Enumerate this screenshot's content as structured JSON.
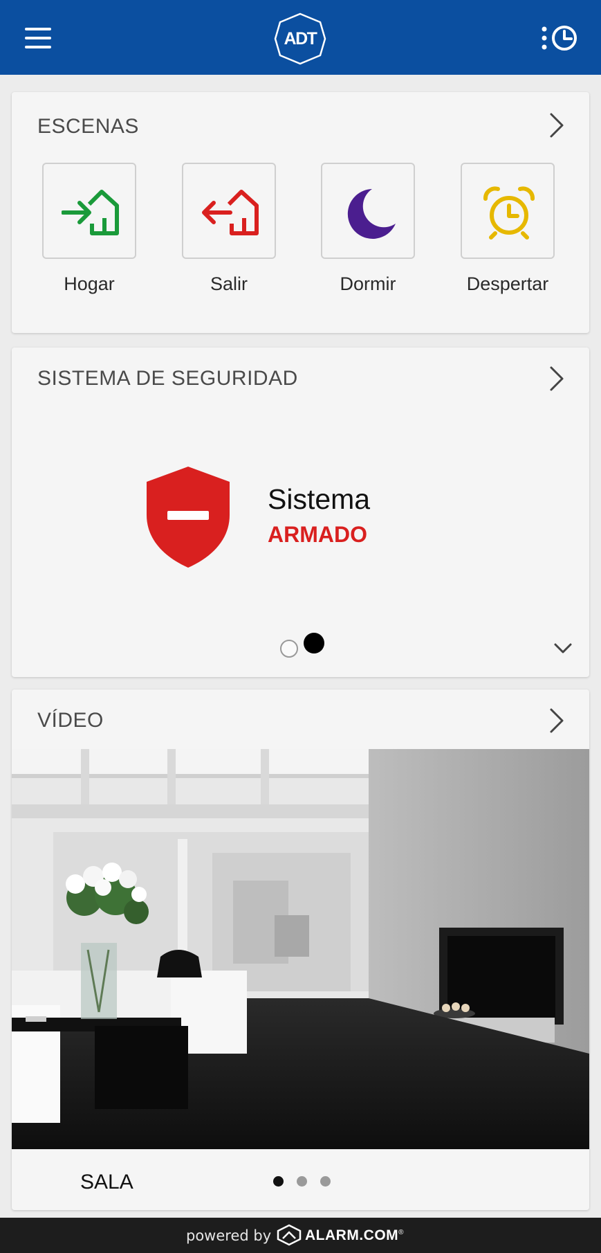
{
  "header": {
    "logo_text": "ADT",
    "menu_icon": "hamburger-menu-icon",
    "history_icon": "activity-history-icon",
    "bar_color": "#0b4fa0"
  },
  "scenes": {
    "title": "ESCENAS",
    "items": [
      {
        "label": "Hogar",
        "icon": "arrive-home-icon",
        "color": "#1a9a3a"
      },
      {
        "label": "Salir",
        "icon": "leave-home-icon",
        "color": "#d9201f"
      },
      {
        "label": "Dormir",
        "icon": "moon-icon",
        "color": "#4b1e8f"
      },
      {
        "label": "Despertar",
        "icon": "alarm-clock-icon",
        "color": "#e6b800"
      }
    ]
  },
  "security": {
    "title": "SISTEMA DE SEGURIDAD",
    "system_label": "Sistema",
    "state": "ARMADO",
    "state_color": "#d9201f",
    "shield_icon": "armed-shield-icon",
    "page_index": 2,
    "page_count": 2
  },
  "video": {
    "title": "VÍDEO",
    "camera_name": "SALA",
    "page_index": 1,
    "page_count": 3
  },
  "footer": {
    "powered_by": "powered by",
    "brand": "ALARM.COM",
    "brand_mark": "®"
  }
}
